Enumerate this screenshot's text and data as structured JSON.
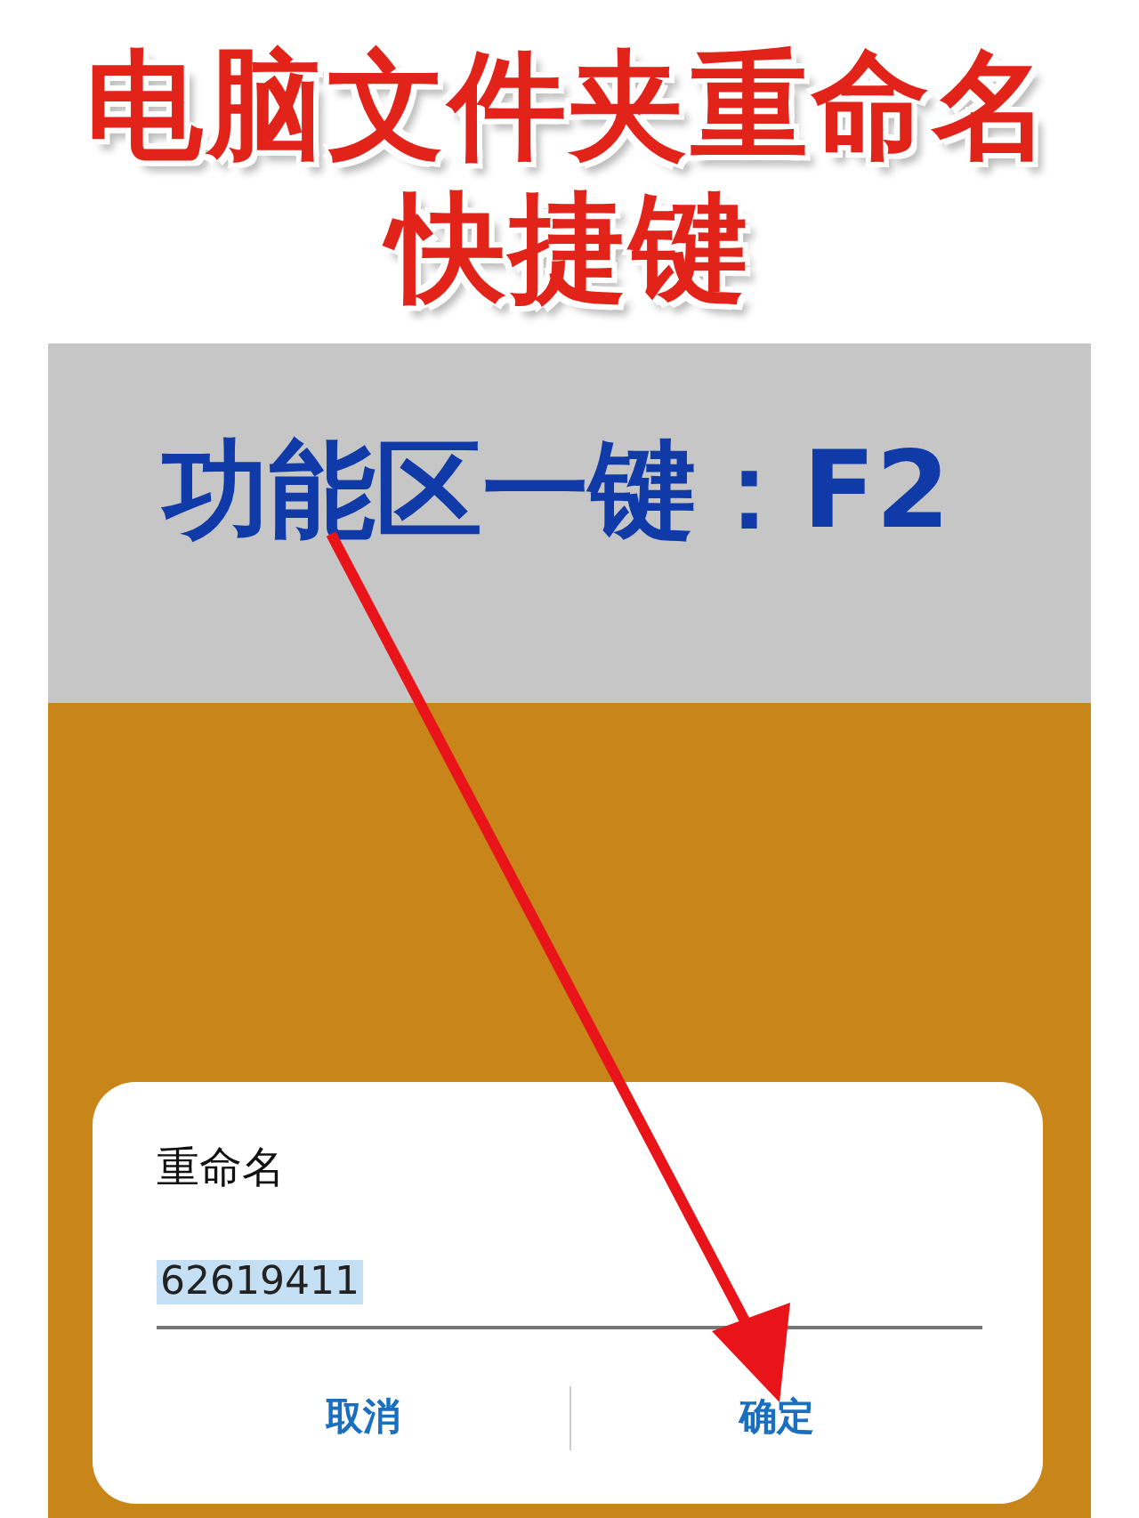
{
  "headline": {
    "lines": [
      "电脑文件夹重命名",
      "快捷键"
    ]
  },
  "banner": {
    "text": "功能区一键：F2"
  },
  "dialog": {
    "title": "重命名",
    "value": "62619411",
    "value_selected": true,
    "buttons": [
      {
        "label": "取消"
      },
      {
        "label": "确定"
      }
    ]
  }
}
